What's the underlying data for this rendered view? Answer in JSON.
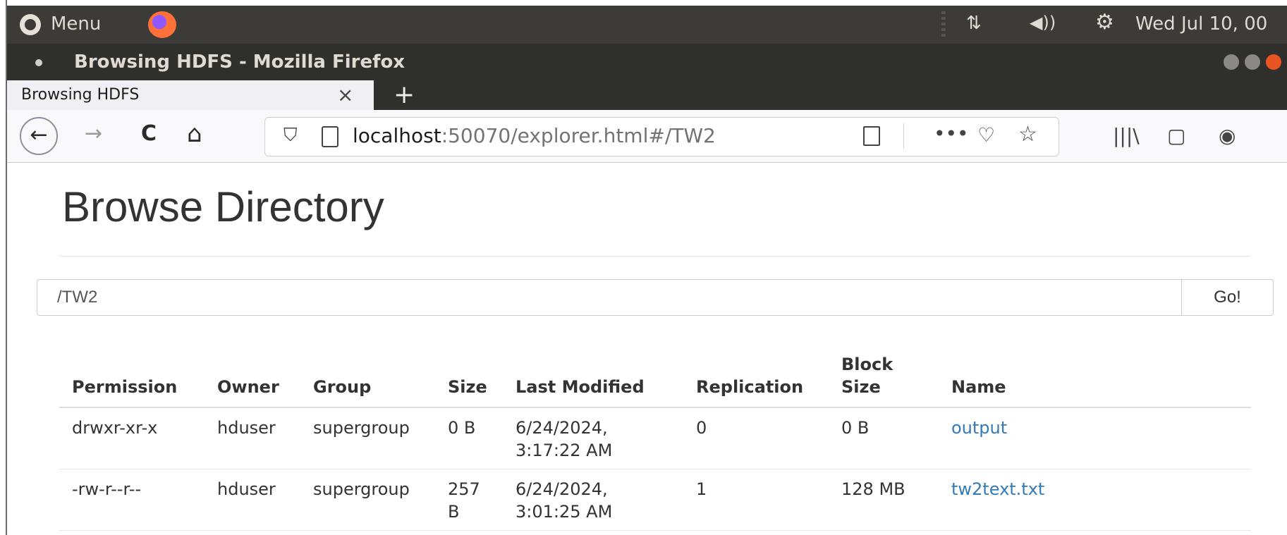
{
  "system_panel": {
    "menu_label": "Menu",
    "clock": "Wed Jul 10, 00"
  },
  "window": {
    "title": "Browsing HDFS - Mozilla Firefox"
  },
  "tabs": [
    {
      "label": "Browsing HDFS",
      "active": true
    }
  ],
  "new_tab_label": "+",
  "navbar": {
    "back": "←",
    "forward": "→",
    "reload": "C",
    "home": "⌂",
    "url_host": "localhost",
    "url_rest": ":50070/explorer.html#/TW2",
    "more": "•••"
  },
  "page": {
    "heading": "Browse Directory",
    "path_value": "/TW2",
    "go_label": "Go!",
    "columns": [
      "Permission",
      "Owner",
      "Group",
      "Size",
      "Last Modified",
      "Replication",
      "Block Size",
      "Name"
    ],
    "rows": [
      {
        "permission": "drwxr-xr-x",
        "owner": "hduser",
        "group": "supergroup",
        "size": "0 B",
        "last_modified": "6/24/2024, 3:17:22 AM",
        "replication": "0",
        "block_size": "0 B",
        "name": "output"
      },
      {
        "permission": "-rw-r--r--",
        "owner": "hduser",
        "group": "supergroup",
        "size": "257 B",
        "last_modified": "6/24/2024, 3:01:25 AM",
        "replication": "1",
        "block_size": "128 MB",
        "name": "tw2text.txt"
      }
    ]
  },
  "colors": {
    "panel_bg": "#3c3b37",
    "titlebar_bg": "#2f2f2b",
    "link": "#337ab7",
    "heading_text": "#333333"
  }
}
